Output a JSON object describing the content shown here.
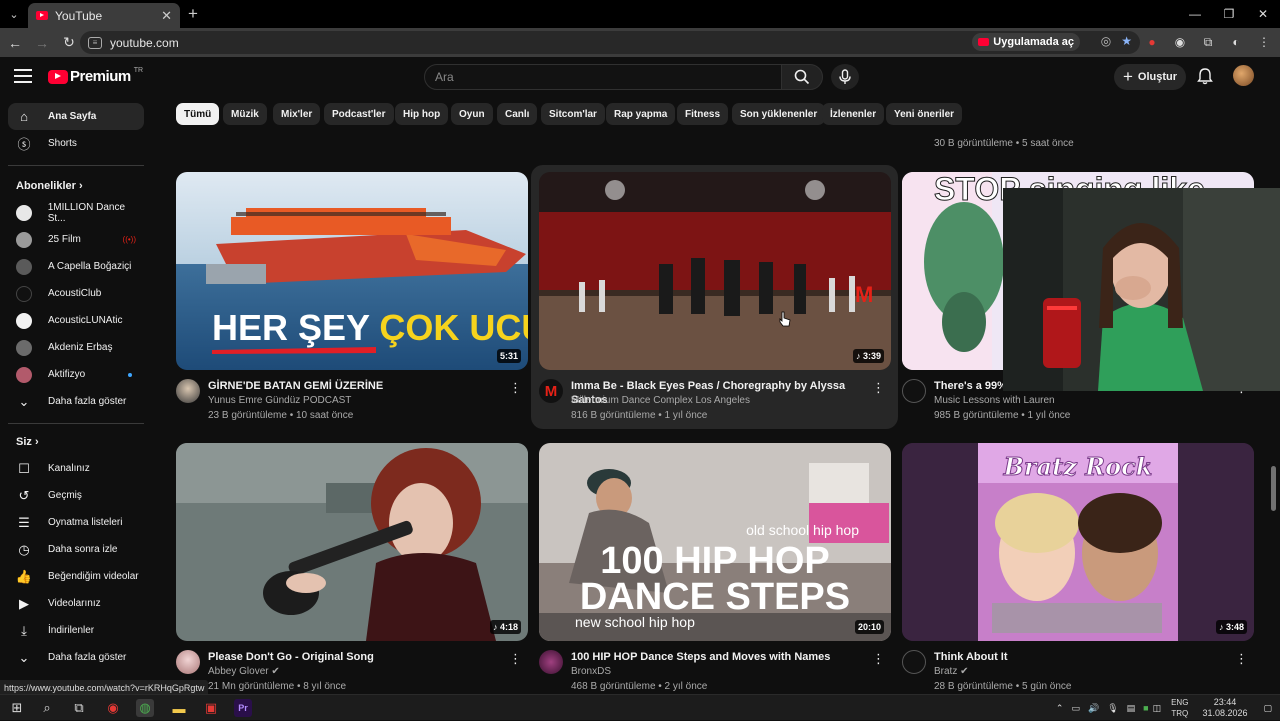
{
  "browser": {
    "tab_title": "YouTube",
    "url": "youtube.com",
    "open_in_app": "Uygulamada aç",
    "status_url": "https://www.youtube.com/watch?v=rKRHqGpRgtw"
  },
  "header": {
    "logo_text": "Premium",
    "country_code": "TR",
    "search_placeholder": "Ara",
    "create_label": "Oluştur"
  },
  "sidebar": {
    "main": [
      {
        "label": "Ana Sayfa",
        "icon": "home-icon"
      },
      {
        "label": "Shorts",
        "icon": "shorts-icon"
      }
    ],
    "subscriptions_title": "Abonelikler",
    "subscriptions": [
      {
        "label": "1MILLION Dance St...",
        "color": "#e8e8e8"
      },
      {
        "label": "25 Film",
        "color": "#9a9a9a",
        "live": true
      },
      {
        "label": "A Capella Boğaziçi",
        "color": "#5a5a5a"
      },
      {
        "label": "AcoustiClub",
        "color": "#111111"
      },
      {
        "label": "AcousticLUNAtic",
        "color": "#f2f2f2"
      },
      {
        "label": "Akdeniz Erbaş",
        "color": "#6b6b6b"
      },
      {
        "label": "Aktifizyo",
        "color": "#b25a6b",
        "new": true
      },
      {
        "label": "Daha fazla göster",
        "icon": "chevron-down-icon"
      }
    ],
    "you_title": "Siz",
    "you": [
      {
        "label": "Kanalınız",
        "icon": "channel-icon"
      },
      {
        "label": "Geçmiş",
        "icon": "history-icon"
      },
      {
        "label": "Oynatma listeleri",
        "icon": "playlist-icon"
      },
      {
        "label": "Daha sonra izle",
        "icon": "clock-icon"
      },
      {
        "label": "Beğendiğim videolar",
        "icon": "like-icon"
      },
      {
        "label": "Videolarınız",
        "icon": "video-icon"
      },
      {
        "label": "İndirilenler",
        "icon": "download-icon"
      },
      {
        "label": "Daha fazla göster",
        "icon": "chevron-down-icon"
      }
    ]
  },
  "chips": [
    "Tümü",
    "Müzik",
    "Mix'ler",
    "Podcast'ler",
    "Hip hop",
    "Oyun",
    "Canlı",
    "Sitcom'lar",
    "Rap yapma",
    "Fitness",
    "Son yüklenenler",
    "İzlenenler",
    "Yeni öneriler"
  ],
  "partial_row_meta": "30 B görüntüleme • 5 saat önce",
  "videos": [
    {
      "title": "GİRNE'DE BATAN GEMİ ÜZERİNE",
      "channel": "Yunus Emre Gündüz PODCAST",
      "meta": "23 B görüntüleme • 10 saat önce",
      "duration": "5:31",
      "thumb_text_1": "HER ŞEY ",
      "thumb_text_2": "ÇOK UCUZ"
    },
    {
      "title": "Imma Be  -  Black Eyes Peas  / Choregraphy by Alyssa Santos",
      "channel": "Millennium Dance Complex Los Angeles",
      "meta": "816 B görüntüleme • 1 yıl önce",
      "duration": "3:39"
    },
    {
      "title": "There's a 99% c",
      "channel": "Music Lessons with Lauren",
      "meta": "985 B görüntüleme • 1 yıl önce",
      "duration": "",
      "thumb_text": "STOP singing like"
    },
    {
      "title": "Please Don't Go - Original Song",
      "channel": "Abbey Glover",
      "meta": "21 Mn görüntüleme • 8 yıl önce",
      "duration": "4:18"
    },
    {
      "title": "100 HIP HOP Dance Steps and Moves with Names",
      "channel": "BronxDS",
      "meta": "468 B görüntüleme • 2 yıl önce",
      "duration": "20:10",
      "thumb_top": "old school hip hop",
      "thumb_big_1": "100 HIP HOP",
      "thumb_big_2": "DANCE STEPS",
      "thumb_bottom": "new school hip hop"
    },
    {
      "title": "Think About It",
      "channel": "Bratz",
      "meta": "28 B görüntüleme • 5 gün önce",
      "duration": "3:48",
      "thumb_text": "Bratz Rock"
    }
  ],
  "taskbar": {
    "lang_1": "ENG",
    "lang_2": "TRQ",
    "time": "23:44",
    "date": "31.08.2026"
  }
}
